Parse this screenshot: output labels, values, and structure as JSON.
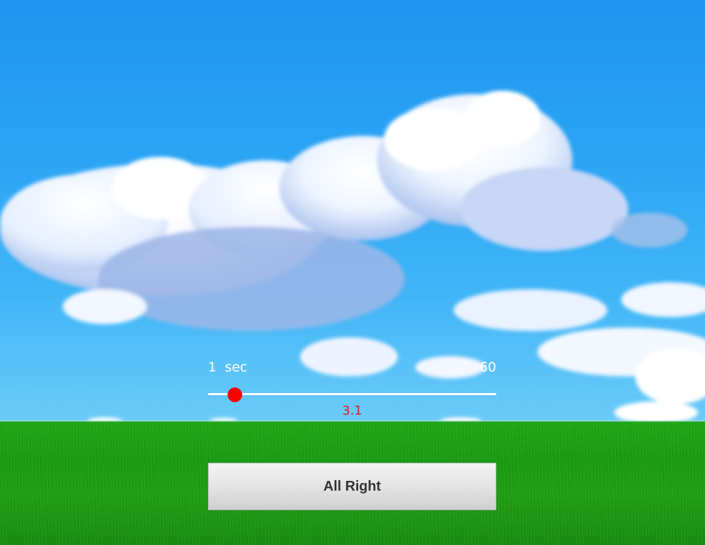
{
  "slider": {
    "min_label": "1  sec",
    "max_label": "60",
    "value_text": "3.1",
    "min": 1,
    "max": 60,
    "value": 3.1,
    "track_color": "#ffffff",
    "thumb_color": "#ff0000",
    "value_color": "#e8122a"
  },
  "button": {
    "label": "All Right"
  },
  "background": {
    "sky_color": "#2aa3f4",
    "grass_color": "#1f9e16"
  }
}
